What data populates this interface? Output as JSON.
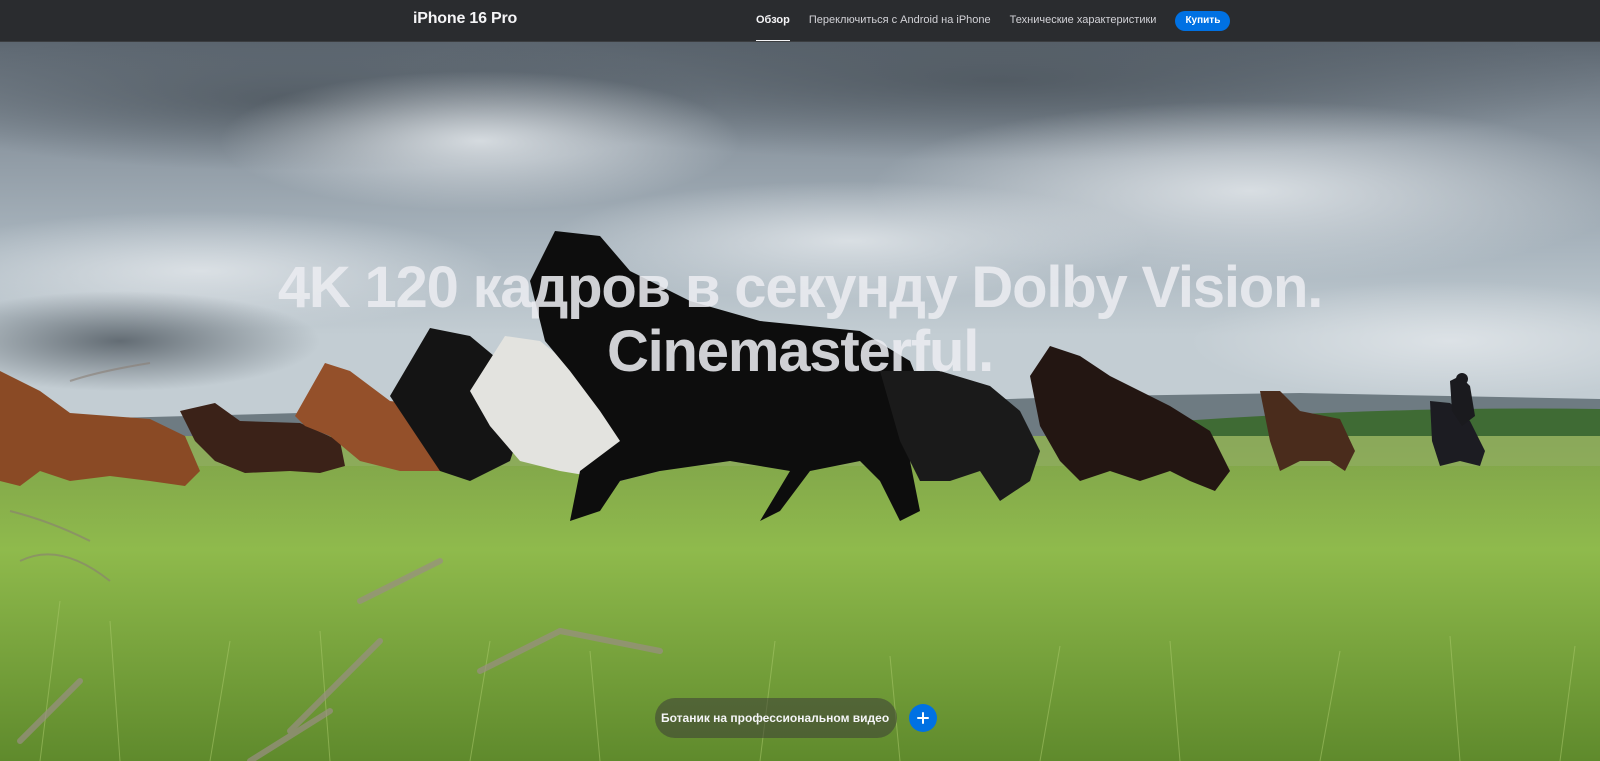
{
  "nav": {
    "product_title": "iPhone 16 Pro",
    "links": [
      {
        "label": "Обзор",
        "active": true
      },
      {
        "label": "Переключиться с Android на iPhone",
        "active": false
      },
      {
        "label": "Технические характеристики",
        "active": false
      }
    ],
    "buy_label": "Купить"
  },
  "hero": {
    "headline_line1": "4K 120 кадров в секунду Dolby Vision.",
    "headline_line2": "Cinemasterful.",
    "video_pill_label": "Ботаник на профессиональном видео",
    "plus_icon": "plus-icon"
  },
  "colors": {
    "nav_background": "#2a2c2f",
    "accent": "#0071e3",
    "headline": "#ebecf0"
  }
}
